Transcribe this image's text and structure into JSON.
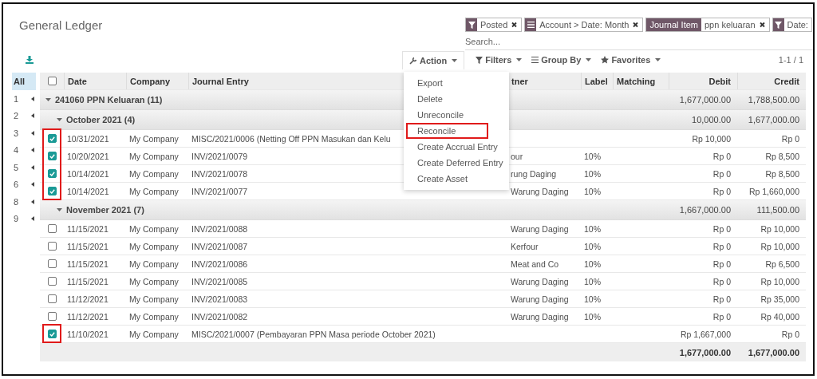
{
  "title": "General Ledger",
  "facets": [
    {
      "kind": "filter",
      "values": [
        "Posted"
      ],
      "closable": true
    },
    {
      "kind": "groupby",
      "values": [
        "Account > Date: Month"
      ],
      "closable": true
    },
    {
      "kind": "field",
      "label": "Journal Item",
      "values": [
        "ppn keluaran"
      ],
      "closable": true
    },
    {
      "kind": "filter",
      "values": [
        "Date:"
      ],
      "closable": false
    }
  ],
  "search": {
    "placeholder": "Search..."
  },
  "toolbar": {
    "action": "Action",
    "filters": "Filters",
    "group_by": "Group By",
    "favorites": "Favorites",
    "pager": "1-1 / 1"
  },
  "action_menu": [
    {
      "label": "Export",
      "highlighted": false
    },
    {
      "label": "Delete",
      "highlighted": false
    },
    {
      "label": "Unreconcile",
      "highlighted": false
    },
    {
      "label": "Reconcile",
      "highlighted": true
    },
    {
      "label": "Create Accrual Entry",
      "highlighted": false
    },
    {
      "label": "Create Deferred Entry",
      "highlighted": false
    },
    {
      "label": "Create Asset",
      "highlighted": false
    }
  ],
  "index": {
    "all": {
      "label": "All",
      "selected": true
    },
    "items": [
      "1",
      "2",
      "3",
      "4",
      "5",
      "6",
      "8",
      "9"
    ]
  },
  "table": {
    "select_all": {
      "checked": false
    },
    "columns": [
      "Date",
      "Company",
      "Journal Entry",
      "tner",
      "Label",
      "Matching",
      "Debit",
      "Credit"
    ],
    "groups": [
      {
        "label": "241060 PPN Keluaran (11)",
        "debit": "1,677,000.00",
        "credit": "1,788,500.00",
        "expanded": true,
        "children": [
          {
            "label": "October 2021 (4)",
            "debit": "10,000.00",
            "credit": "1,677,000.00",
            "expanded": true,
            "rows": [
              {
                "checked": true,
                "highlighted": true,
                "date": "10/31/2021",
                "company": "My Company",
                "entry": "MISC/2021/0006 (Netting Off PPN Masukan dan Kelu",
                "partner": "",
                "label": "",
                "debit": "Rp 10,000",
                "credit": "Rp 0"
              },
              {
                "checked": true,
                "highlighted": true,
                "date": "10/20/2021",
                "company": "My Company",
                "entry": "INV/2021/0079",
                "partner": "our",
                "label": "10%",
                "debit": "Rp 0",
                "credit": "Rp 8,500"
              },
              {
                "checked": true,
                "highlighted": true,
                "date": "10/14/2021",
                "company": "My Company",
                "entry": "INV/2021/0078",
                "partner": "rung Daging",
                "label": "10%",
                "debit": "Rp 0",
                "credit": "Rp 8,500"
              },
              {
                "checked": true,
                "highlighted": true,
                "date": "10/14/2021",
                "company": "My Company",
                "entry": "INV/2021/0077",
                "partner": "Warung Daging",
                "label": "10%",
                "debit": "Rp 0",
                "credit": "Rp 1,660,000"
              }
            ]
          },
          {
            "label": "November 2021 (7)",
            "debit": "1,667,000.00",
            "credit": "111,500.00",
            "expanded": true,
            "rows": [
              {
                "checked": false,
                "highlighted": false,
                "date": "11/15/2021",
                "company": "My Company",
                "entry": "INV/2021/0088",
                "partner": "Warung Daging",
                "label": "10%",
                "debit": "Rp 0",
                "credit": "Rp 10,000"
              },
              {
                "checked": false,
                "highlighted": false,
                "date": "11/15/2021",
                "company": "My Company",
                "entry": "INV/2021/0087",
                "partner": "Kerfour",
                "label": "10%",
                "debit": "Rp 0",
                "credit": "Rp 10,000"
              },
              {
                "checked": false,
                "highlighted": false,
                "date": "11/15/2021",
                "company": "My Company",
                "entry": "INV/2021/0086",
                "partner": "Meat and Co",
                "label": "10%",
                "debit": "Rp 0",
                "credit": "Rp 6,500"
              },
              {
                "checked": false,
                "highlighted": false,
                "date": "11/15/2021",
                "company": "My Company",
                "entry": "INV/2021/0085",
                "partner": "Warung Daging",
                "label": "10%",
                "debit": "Rp 0",
                "credit": "Rp 10,000"
              },
              {
                "checked": false,
                "highlighted": false,
                "date": "11/12/2021",
                "company": "My Company",
                "entry": "INV/2021/0083",
                "partner": "Warung Daging",
                "label": "10%",
                "debit": "Rp 0",
                "credit": "Rp 35,000"
              },
              {
                "checked": false,
                "highlighted": false,
                "date": "11/12/2021",
                "company": "My Company",
                "entry": "INV/2021/0082",
                "partner": "Warung Daging",
                "label": "10%",
                "debit": "Rp 0",
                "credit": "Rp 40,000"
              },
              {
                "checked": true,
                "highlighted": true,
                "date": "11/10/2021",
                "company": "My Company",
                "entry": "MISC/2021/0007 (Pembayaran PPN Masa periode October 2021)",
                "partner": "",
                "label": "",
                "debit": "Rp 1,667,000",
                "credit": "Rp 0"
              }
            ]
          }
        ]
      }
    ],
    "totals": {
      "debit": "1,677,000.00",
      "credit": "1,677,000.00"
    }
  }
}
